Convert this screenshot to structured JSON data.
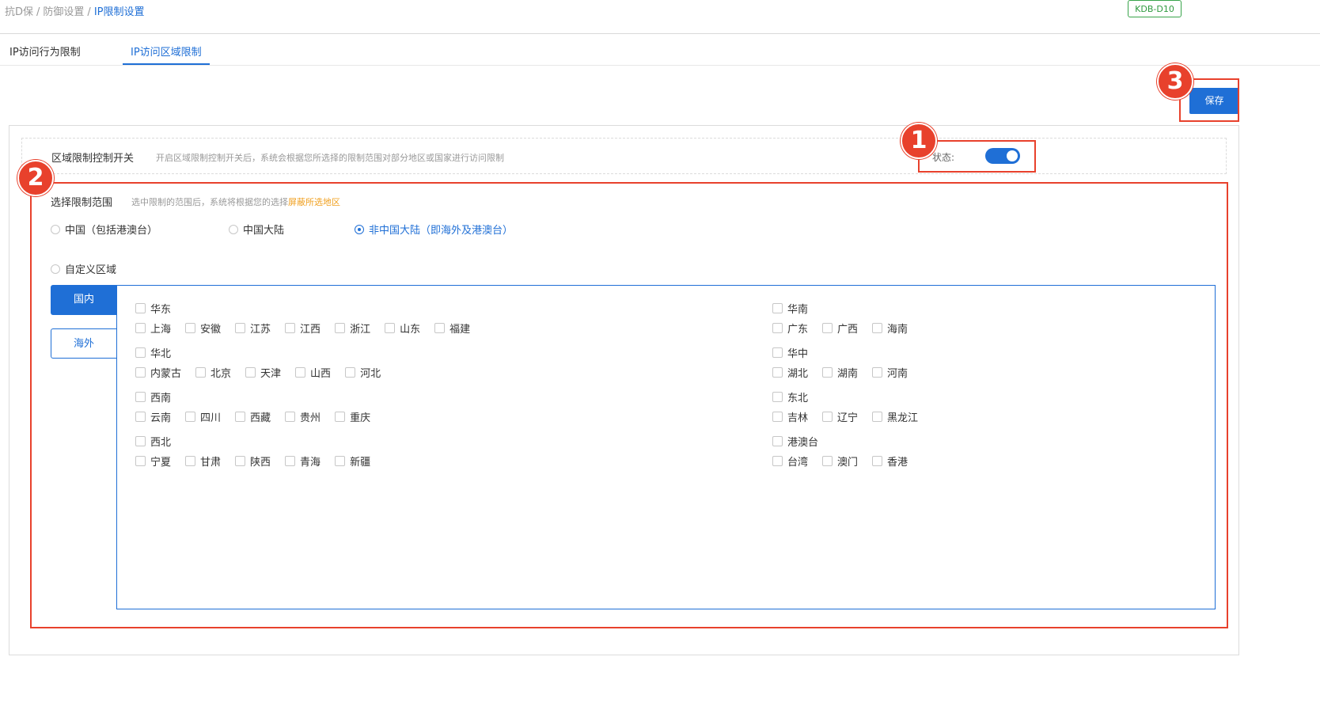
{
  "breadcrumb": {
    "items": [
      "抗D保",
      "防御设置",
      "IP限制设置"
    ],
    "separator": "/"
  },
  "badge": "KDB-D10",
  "tabs": [
    {
      "label": "IP访问行为限制",
      "active": false
    },
    {
      "label": "IP访问区域限制",
      "active": true
    }
  ],
  "save_label": "保存",
  "switch_row": {
    "title": "区域限制控制开关",
    "desc": "开启区域限制控制开关后，系统会根据您所选择的限制范围对部分地区或国家进行访问限制",
    "status_label": "状态:",
    "enabled": true
  },
  "scope": {
    "title": "选择限制范围",
    "desc_prefix": "选中限制的范围后，系统将根据您的选择",
    "desc_highlight": "屏蔽所选地区",
    "options": [
      {
        "label": "中国（包括港澳台）",
        "checked": false
      },
      {
        "label": "中国大陆",
        "checked": false
      },
      {
        "label": "非中国大陆（即海外及港澳台）",
        "checked": true
      },
      {
        "label": "自定义区域",
        "checked": false
      }
    ]
  },
  "side_tabs": [
    {
      "label": "国内",
      "active": true
    },
    {
      "label": "海外",
      "active": false
    }
  ],
  "regions": {
    "east": {
      "name": "华东",
      "items": [
        "上海",
        "安徽",
        "江苏",
        "江西",
        "浙江",
        "山东",
        "福建"
      ]
    },
    "north": {
      "name": "华北",
      "items": [
        "内蒙古",
        "北京",
        "天津",
        "山西",
        "河北"
      ]
    },
    "southwest": {
      "name": "西南",
      "items": [
        "云南",
        "四川",
        "西藏",
        "贵州",
        "重庆"
      ]
    },
    "northwest": {
      "name": "西北",
      "items": [
        "宁夏",
        "甘肃",
        "陕西",
        "青海",
        "新疆"
      ]
    },
    "south": {
      "name": "华南",
      "items": [
        "广东",
        "广西",
        "海南"
      ]
    },
    "central": {
      "name": "华中",
      "items": [
        "湖北",
        "湖南",
        "河南"
      ]
    },
    "northeast": {
      "name": "东北",
      "items": [
        "吉林",
        "辽宁",
        "黑龙江"
      ]
    },
    "hmt": {
      "name": "港澳台",
      "items": [
        "台湾",
        "澳门",
        "香港"
      ]
    }
  },
  "annotations": [
    "1",
    "2",
    "3"
  ],
  "colors": {
    "accent": "#1f6fd6",
    "annotation": "#e8412c",
    "highlight": "#f0a020",
    "badge": "#38a34a"
  }
}
